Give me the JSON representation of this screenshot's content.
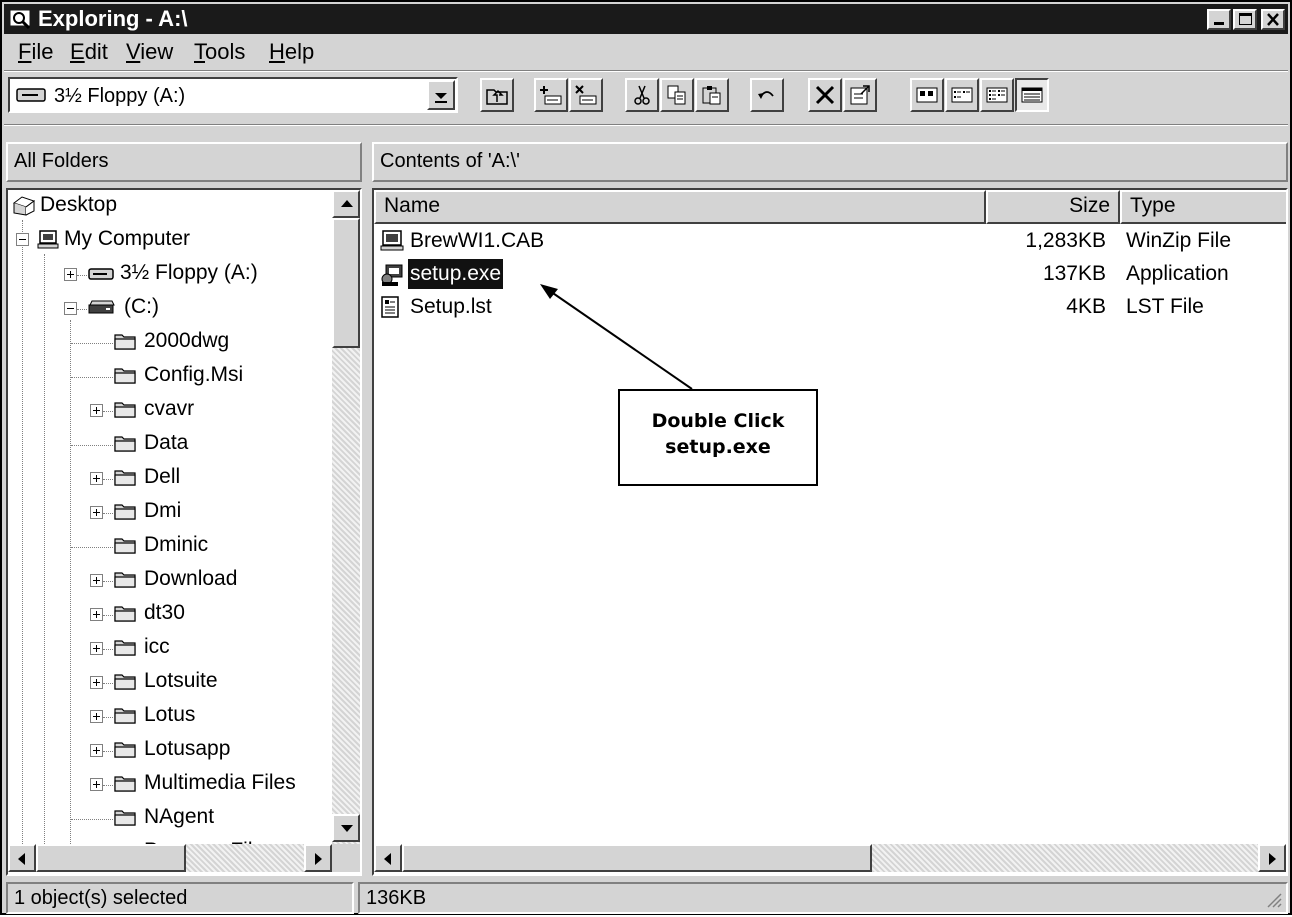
{
  "window": {
    "title": "Exploring - A:\\",
    "controls": [
      "minimize",
      "maximize",
      "close"
    ]
  },
  "menu": [
    {
      "label": "File",
      "underline": "F",
      "rest": "ile"
    },
    {
      "label": "Edit",
      "underline": "E",
      "rest": "dit"
    },
    {
      "label": "View",
      "underline": "V",
      "rest": "iew"
    },
    {
      "label": "Tools",
      "underline": "T",
      "rest": "ools"
    },
    {
      "label": "Help",
      "underline": "H",
      "rest": "elp"
    }
  ],
  "toolbar": {
    "address_value": "3½ Floppy (A:)",
    "buttons": [
      "up-one-level",
      "map-network-drive",
      "disconnect-network-drive",
      "cut",
      "copy",
      "paste",
      "undo",
      "delete",
      "properties",
      "large-icons",
      "small-icons",
      "list",
      "details"
    ],
    "active_view": "details"
  },
  "panes": {
    "left_header": "All Folders",
    "right_header": "Contents of 'A:\\'"
  },
  "tree": [
    {
      "label": "Desktop",
      "icon": "desktop-icon"
    },
    {
      "label": "My Computer",
      "icon": "computer-icon"
    },
    {
      "label": "3½ Floppy (A:)",
      "icon": "floppy-drive-icon"
    },
    {
      "label": "(C:)",
      "icon": "hard-drive-icon"
    },
    {
      "label": "2000dwg",
      "icon": "folder-icon"
    },
    {
      "label": "Config.Msi",
      "icon": "folder-icon"
    },
    {
      "label": "cvavr",
      "icon": "folder-icon"
    },
    {
      "label": "Data",
      "icon": "folder-icon"
    },
    {
      "label": "Dell",
      "icon": "folder-icon"
    },
    {
      "label": "Dmi",
      "icon": "folder-icon"
    },
    {
      "label": "Dminic",
      "icon": "folder-icon"
    },
    {
      "label": "Download",
      "icon": "folder-icon"
    },
    {
      "label": "dt30",
      "icon": "folder-icon"
    },
    {
      "label": "icc",
      "icon": "folder-icon"
    },
    {
      "label": "Lotsuite",
      "icon": "folder-icon"
    },
    {
      "label": "Lotus",
      "icon": "folder-icon"
    },
    {
      "label": "Lotusapp",
      "icon": "folder-icon"
    },
    {
      "label": "Multimedia Files",
      "icon": "folder-icon"
    },
    {
      "label": "NAgent",
      "icon": "folder-icon"
    },
    {
      "label": "Program Files",
      "icon": "folder-icon"
    }
  ],
  "columns": {
    "name": "Name",
    "size": "Size",
    "type": "Type"
  },
  "files": [
    {
      "name": "BrewWI1.CAB",
      "size": "1,283KB",
      "type": "WinZip File",
      "icon": "cabinet-file-icon",
      "selected": false
    },
    {
      "name": "setup.exe",
      "size": "137KB",
      "type": "Application",
      "icon": "setup-application-icon",
      "selected": true
    },
    {
      "name": "Setup.lst",
      "size": "4KB",
      "type": "LST File",
      "icon": "text-file-icon",
      "selected": false
    }
  ],
  "callout": {
    "line1": "Double Click",
    "line2": "setup.exe"
  },
  "status": {
    "left": "1 object(s) selected",
    "right": "136KB"
  }
}
